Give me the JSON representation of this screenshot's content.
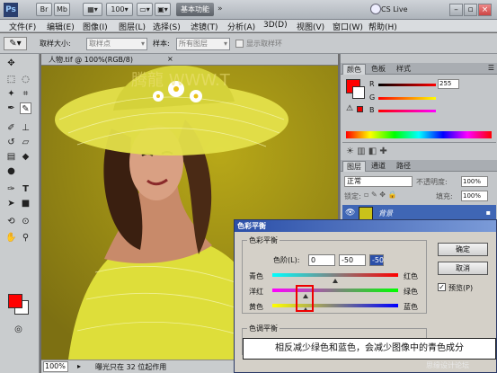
{
  "titlebar": {
    "essentials_label": "基本功能",
    "cslive_label": "CS Live"
  },
  "menu": [
    "文件(F)",
    "编辑(E)",
    "图像(I)",
    "图层(L)",
    "选择(S)",
    "滤镜(T)",
    "分析(A)",
    "3D(D)",
    "视图(V)",
    "窗口(W)",
    "帮助(H)"
  ],
  "options_bar": {
    "sample_size_label": "取样大小:",
    "sample_size_value": "取样点",
    "sample_label": "样本:",
    "sample_value": "所有图层",
    "show_ring_label": "显示取样环"
  },
  "document": {
    "tab_title": "人物.tif @ 100%(RGB/8)",
    "zoom": "100%",
    "status_text": "曝光只在 32 位起作用",
    "watermark_text": "腾龍 WWW.T"
  },
  "color_panel": {
    "tabs": [
      "颜色",
      "色板",
      "样式"
    ],
    "r_value": "255",
    "g_value": "0",
    "b_value": "0"
  },
  "layers_panel": {
    "tabs": [
      "图层",
      "通道",
      "路径"
    ],
    "blend_mode": "正常",
    "opacity_label": "不透明度:",
    "opacity_value": "100%",
    "lock_label": "锁定:",
    "fill_label": "填充:",
    "fill_value": "100%",
    "layer_name": "背景"
  },
  "dialog": {
    "title": "色彩平衡",
    "group_color_balance": "色彩平衡",
    "levels_label": "色阶(L):",
    "levels": [
      "0",
      "-50",
      "-50"
    ],
    "ok_label": "确定",
    "cancel_label": "取消",
    "preview_label": "预览(P)",
    "sliders": [
      {
        "left": "青色",
        "right": "红色",
        "value": 0
      },
      {
        "left": "洋红",
        "right": "绿色",
        "value": -50
      },
      {
        "left": "黄色",
        "right": "蓝色",
        "value": -50
      }
    ],
    "group_tone_balance": "色调平衡"
  },
  "caption": "相反减少绿色和蓝色，会减少图像中的青色成分",
  "site_watermark": "思缘设计论坛",
  "colors": {
    "foreground": "#ff0000",
    "background": "#ffffff",
    "canvas_yellow": "#c9c21a"
  }
}
